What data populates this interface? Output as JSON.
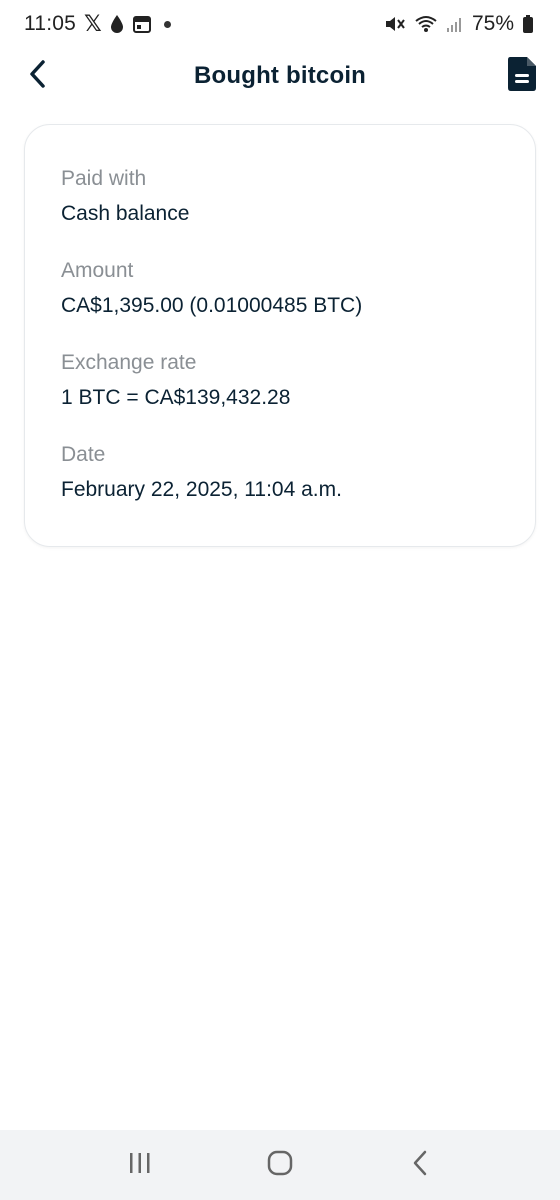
{
  "status_bar": {
    "time": "11:05",
    "battery_percent": "75%",
    "icons": [
      "x-icon",
      "drop-icon",
      "calendar-icon",
      "dot-icon",
      "mute-icon",
      "wifi-icon",
      "signal-icon",
      "battery-icon"
    ]
  },
  "header": {
    "title": "Bought bitcoin",
    "back_icon": "chevron-left-icon",
    "action_icon": "document-icon"
  },
  "details": [
    {
      "label": "Paid with",
      "value": "Cash balance"
    },
    {
      "label": "Amount",
      "value": "CA$1,395.00 (0.01000485 BTC)"
    },
    {
      "label": "Exchange rate",
      "value": "1 BTC = CA$139,432.28"
    },
    {
      "label": "Date",
      "value": "February 22, 2025, 11:04 a.m."
    }
  ],
  "nav_bar": {
    "icons": [
      "recent-apps-icon",
      "home-icon",
      "back-icon"
    ]
  },
  "colors": {
    "text_primary": "#0b2233",
    "text_secondary": "#8a8f94",
    "card_border": "#e6e9ec",
    "nav_bg": "#f2f3f5"
  }
}
